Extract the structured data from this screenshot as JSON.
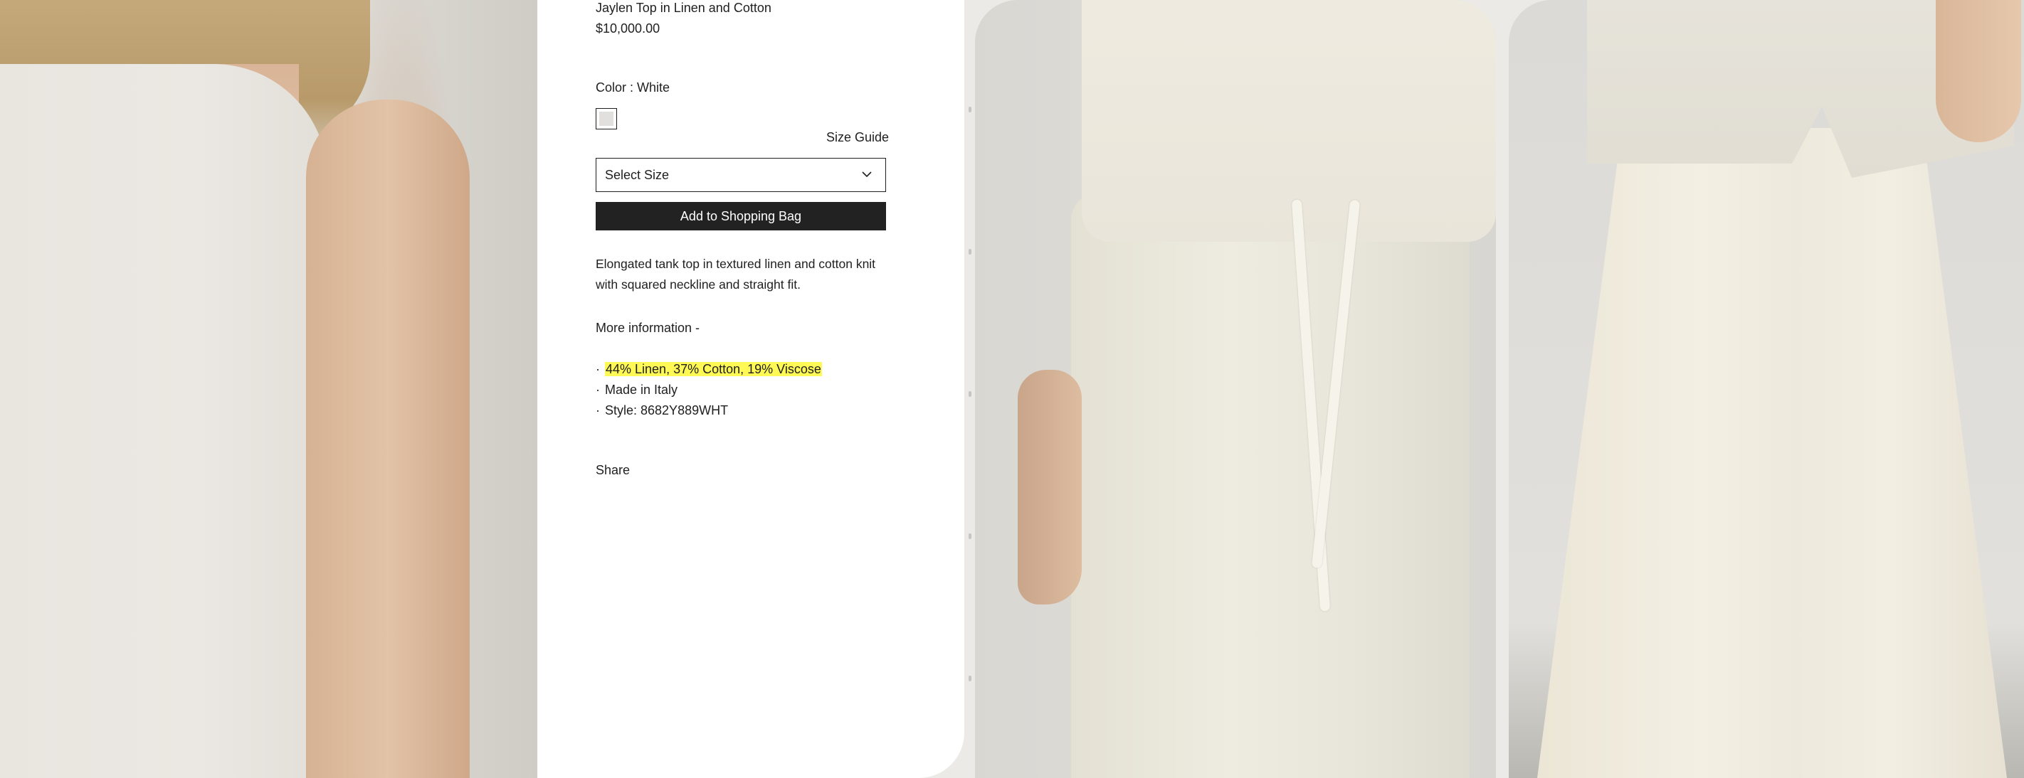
{
  "product": {
    "title": "Jaylen Top in Linen and Cotton",
    "price": "$10,000.00",
    "color_label": "Color : White",
    "swatch_color": "#e2e0dc",
    "size_guide": "Size Guide",
    "size_select_placeholder": "Select Size",
    "add_to_bag": "Add to Shopping Bag",
    "description": "Elongated tank top in textured linen and cotton knit with squared neckline and straight fit.",
    "more_info_label": "More information -",
    "details": [
      {
        "bullet": "·",
        "text": "44% Linen, 37% Cotton, 19% Viscose",
        "highlighted": true
      },
      {
        "bullet": "·",
        "text": "Made in Italy",
        "highlighted": false
      },
      {
        "bullet": "·",
        "text": "Style: 8682Y889WHT",
        "highlighted": false
      }
    ],
    "share_label": "Share"
  },
  "gallery": {
    "images": [
      {
        "name": "model-top-closeup"
      },
      {
        "name": "model-pants-drawstring"
      },
      {
        "name": "model-skirt-full"
      }
    ]
  },
  "colors": {
    "button_bg": "#222222",
    "highlight": "#fff955",
    "panel_bg": "#ffffff"
  }
}
